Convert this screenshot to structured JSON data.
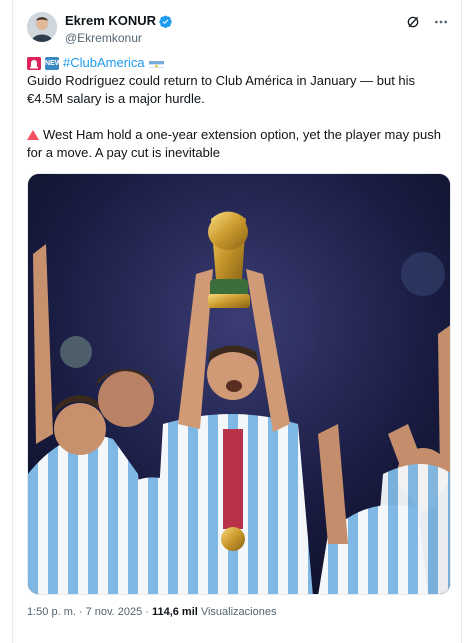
{
  "author": {
    "name": "Ekrem KONUR",
    "handle": "@Ekremkonur"
  },
  "post": {
    "hashtag": "#ClubAmerica",
    "badge_new": "NEW",
    "line1": "Guido Rodríguez could return to Club América in January — but his €4.5M salary is a major hurdle.",
    "line2": "West Ham hold a one-year extension option, yet the player may push for a move.  A pay cut is inevitable"
  },
  "image": {
    "alt": "Footballer in Argentina kit lifting the World Cup trophy with teammates celebrating"
  },
  "footer": {
    "time": "1:50 p. m.",
    "separator": "·",
    "date": "7 nov. 2025",
    "views_count": "114,6 mil",
    "views_label": "Visualizaciones"
  },
  "colors": {
    "link": "#1d9bf0",
    "text": "#0f1419",
    "secondary": "#536471"
  }
}
